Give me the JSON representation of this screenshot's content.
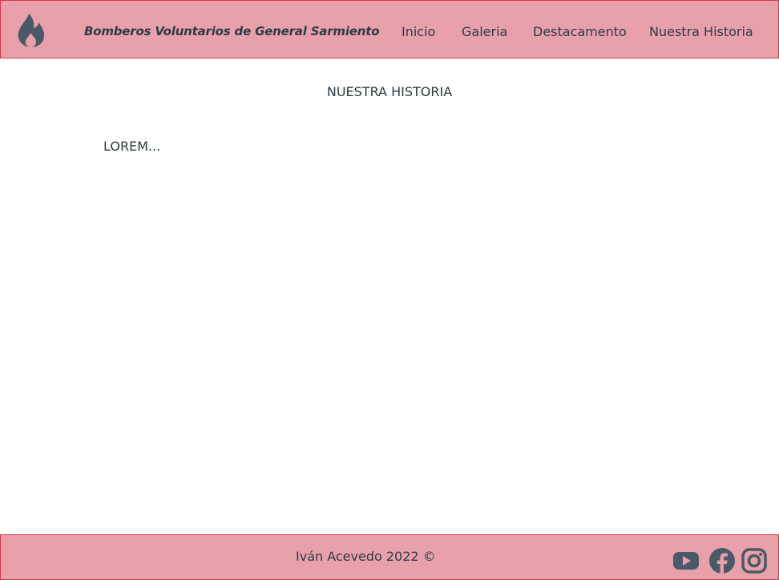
{
  "header": {
    "logo_icon": "flame-icon",
    "brand": "Bomberos Voluntarios de General Sarmiento",
    "nav": [
      {
        "label": "Inicio"
      },
      {
        "label": "Galeria"
      },
      {
        "label": "Destacamento"
      },
      {
        "label": "Nuestra Historia"
      }
    ]
  },
  "main": {
    "title": "NUESTRA HISTORIA",
    "text": "LOREM..."
  },
  "footer": {
    "copyright": "Iván Acevedo 2022 ©",
    "social": [
      {
        "icon": "youtube-icon"
      },
      {
        "icon": "facebook-icon"
      },
      {
        "icon": "instagram-icon"
      }
    ]
  },
  "colors": {
    "bar_background": "#e8a1aa",
    "bar_border": "#d8394e",
    "text": "#2f3a46",
    "icon": "#4a5968"
  }
}
